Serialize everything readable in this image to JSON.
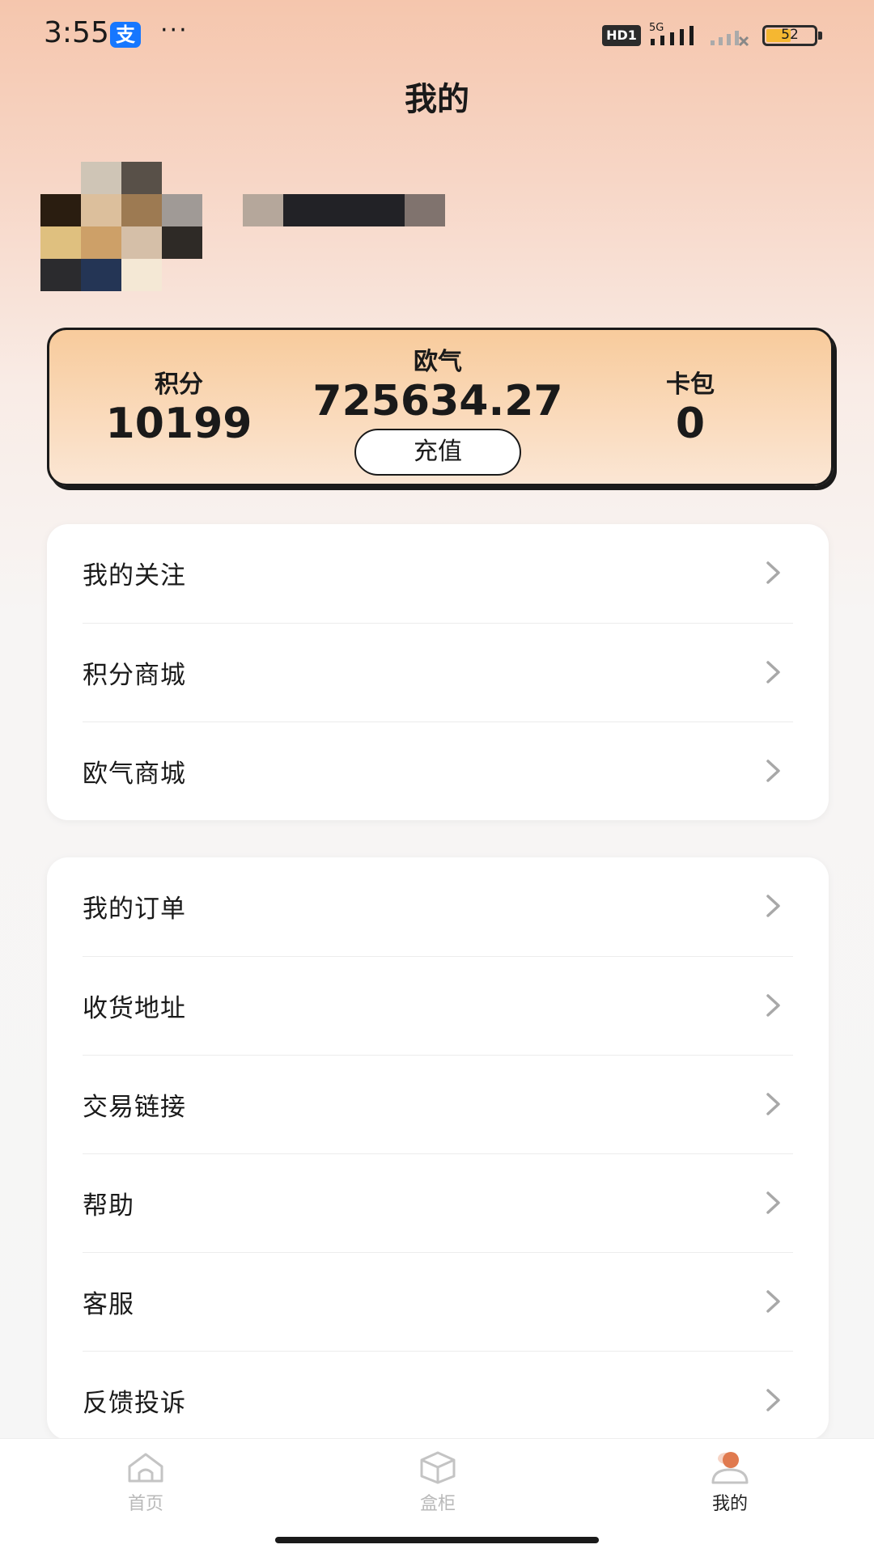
{
  "status_bar": {
    "time": "3:55",
    "alipay_glyph": "支",
    "dots": "···",
    "hd_badge": "HD1",
    "network": "5G",
    "battery": "52",
    "battery_color": "#f5b731"
  },
  "page": {
    "title": "我的"
  },
  "stats": {
    "points_label": "积分",
    "points_value": "10199",
    "luck_label": "欧气",
    "luck_value": "725634.27",
    "recharge_label": "充值",
    "cards_label": "卡包",
    "cards_value": "0"
  },
  "menu_group_1": [
    {
      "label": "我的关注"
    },
    {
      "label": "积分商城"
    },
    {
      "label": "欧气商城"
    }
  ],
  "menu_group_2": [
    {
      "label": "我的订单"
    },
    {
      "label": "收货地址"
    },
    {
      "label": "交易链接"
    },
    {
      "label": "帮助"
    },
    {
      "label": "客服"
    },
    {
      "label": "反馈投诉"
    }
  ],
  "tab_bar": {
    "home_label": "首页",
    "box_label": "盒柜",
    "mine_label": "我的",
    "active": "mine",
    "icons": [
      "home-icon",
      "box-icon",
      "user-icon"
    ]
  },
  "colors": {
    "accent": "#e07a4f",
    "card_gradient_top": "#f8cb9c",
    "card_gradient_bottom": "#fbe6d4"
  }
}
